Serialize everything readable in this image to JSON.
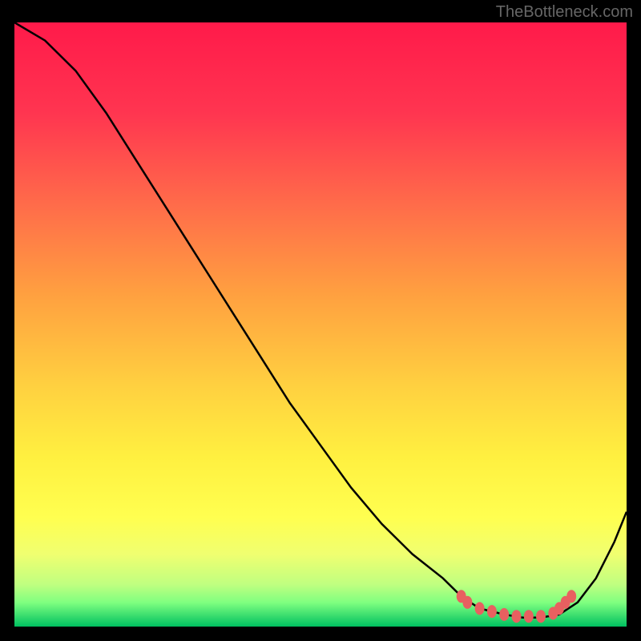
{
  "watermark": "TheBottleneck.com",
  "chart_data": {
    "type": "line",
    "title": "",
    "xlabel": "",
    "ylabel": "",
    "xlim": [
      0,
      100
    ],
    "ylim": [
      0,
      100
    ],
    "gradient_stops": [
      {
        "offset": 0,
        "color": "#ff1a4a"
      },
      {
        "offset": 15,
        "color": "#ff3550"
      },
      {
        "offset": 30,
        "color": "#ff6b4a"
      },
      {
        "offset": 45,
        "color": "#ffa040"
      },
      {
        "offset": 60,
        "color": "#ffd040"
      },
      {
        "offset": 72,
        "color": "#fff040"
      },
      {
        "offset": 82,
        "color": "#ffff50"
      },
      {
        "offset": 88,
        "color": "#f0ff70"
      },
      {
        "offset": 93,
        "color": "#c0ff80"
      },
      {
        "offset": 96,
        "color": "#80ff80"
      },
      {
        "offset": 98,
        "color": "#40e070"
      },
      {
        "offset": 100,
        "color": "#00c060"
      }
    ],
    "curve": {
      "x": [
        0,
        5,
        10,
        15,
        20,
        25,
        30,
        35,
        40,
        45,
        50,
        55,
        60,
        65,
        70,
        73,
        76,
        80,
        83,
        86,
        89,
        92,
        95,
        98,
        100
      ],
      "y": [
        100,
        97,
        92,
        85,
        77,
        69,
        61,
        53,
        45,
        37,
        30,
        23,
        17,
        12,
        8,
        5,
        3,
        2,
        1.5,
        1.5,
        2,
        4,
        8,
        14,
        19
      ]
    },
    "markers": {
      "x": [
        73,
        74,
        76,
        78,
        80,
        82,
        84,
        86,
        88,
        89,
        90,
        91
      ],
      "y": [
        5,
        4,
        3,
        2.5,
        2,
        1.7,
        1.7,
        1.7,
        2.2,
        3,
        4,
        5
      ],
      "color": "#e86060"
    }
  }
}
